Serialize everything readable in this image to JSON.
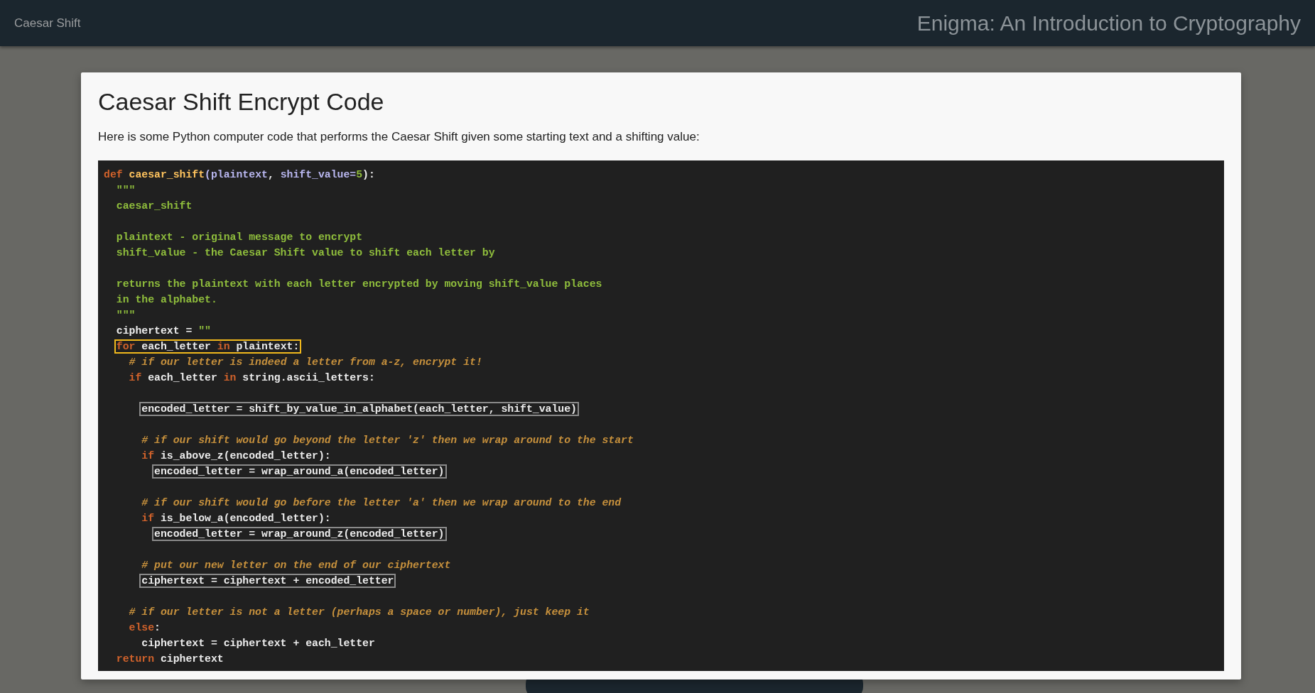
{
  "header": {
    "brand": "Caesar Shift",
    "title": "Enigma: An Introduction to Cryptography"
  },
  "modal": {
    "title": "Caesar Shift Encrypt Code",
    "intro": "Here is some Python computer code that performs the Caesar Shift given some starting text and a shifting value:",
    "lines": [
      {
        "kind": "code",
        "tokens": [
          {
            "kind": "kw",
            "text": "def "
          },
          {
            "kind": "fn",
            "text": "caesar_shift"
          },
          {
            "kind": "param",
            "text": "(plaintext"
          },
          {
            "kind": "plain",
            "text": ", "
          },
          {
            "kind": "param",
            "text": "shift_value="
          },
          {
            "kind": "num",
            "text": "5"
          },
          {
            "kind": "plain",
            "text": "):"
          }
        ],
        "children": [
          {
            "kind": "code",
            "tokens": [
              {
                "kind": "doc",
                "text": "\"\"\""
              }
            ]
          },
          {
            "kind": "code",
            "tokens": [
              {
                "kind": "doc",
                "text": "caesar_shift"
              }
            ]
          },
          {
            "kind": "blank"
          },
          {
            "kind": "code",
            "tokens": [
              {
                "kind": "doc",
                "text": "plaintext - original message to encrypt"
              }
            ]
          },
          {
            "kind": "code",
            "tokens": [
              {
                "kind": "doc",
                "text": "shift_value - the Caesar Shift value to shift each letter by"
              }
            ]
          },
          {
            "kind": "blank"
          },
          {
            "kind": "code",
            "tokens": [
              {
                "kind": "doc",
                "text": "returns the plaintext with each letter encrypted by moving shift_value places"
              }
            ]
          },
          {
            "kind": "code",
            "tokens": [
              {
                "kind": "doc",
                "text": "in the alphabet."
              }
            ]
          },
          {
            "kind": "code",
            "tokens": [
              {
                "kind": "doc",
                "text": "\"\"\""
              }
            ]
          },
          {
            "kind": "code",
            "tokens": [
              {
                "kind": "plain",
                "text": "ciphertext = "
              },
              {
                "kind": "doc",
                "text": "\"\""
              }
            ]
          },
          {
            "kind": "code",
            "boxed": true,
            "color": "#f0b81c",
            "tokens": [
              {
                "kind": "kw",
                "text": "for"
              },
              {
                "kind": "plain",
                "text": " each_letter "
              },
              {
                "kind": "kw",
                "text": "in"
              },
              {
                "kind": "plain",
                "text": " plaintext:"
              }
            ],
            "children": [
              {
                "kind": "code",
                "tokens": [
                  {
                    "kind": "comment",
                    "text": "# if our letter is indeed a letter from a-z, encrypt it!"
                  }
                ]
              },
              {
                "kind": "code",
                "tokens": [
                  {
                    "kind": "kw",
                    "text": "if"
                  },
                  {
                    "kind": "plain",
                    "text": " each_letter "
                  },
                  {
                    "kind": "kw",
                    "text": "in"
                  },
                  {
                    "kind": "plain",
                    "text": " string.ascii_letters:"
                  }
                ],
                "children": [
                  {
                    "kind": "blank"
                  },
                  {
                    "kind": "code",
                    "boxed": true,
                    "color": "#8a8a8a",
                    "tokens": [
                      {
                        "kind": "plain",
                        "text": "encoded_letter = shift_by_value_in_alphabet(each_letter, shift_value)"
                      }
                    ]
                  },
                  {
                    "kind": "blank"
                  },
                  {
                    "kind": "code",
                    "tokens": [
                      {
                        "kind": "comment",
                        "text": "# if our shift would go beyond the letter 'z' then we wrap around to the start"
                      }
                    ]
                  },
                  {
                    "kind": "code",
                    "tokens": [
                      {
                        "kind": "kw",
                        "text": "if"
                      },
                      {
                        "kind": "plain",
                        "text": " is_above_z(encoded_letter):"
                      }
                    ],
                    "children": [
                      {
                        "kind": "code",
                        "boxed": true,
                        "color": "#8a8a8a",
                        "tokens": [
                          {
                            "kind": "plain",
                            "text": "encoded_letter = wrap_around_a(encoded_letter)"
                          }
                        ]
                      }
                    ]
                  },
                  {
                    "kind": "blank"
                  },
                  {
                    "kind": "code",
                    "tokens": [
                      {
                        "kind": "comment",
                        "text": "# if our shift would go before the letter 'a' then we wrap around to the end"
                      }
                    ]
                  },
                  {
                    "kind": "code",
                    "tokens": [
                      {
                        "kind": "kw",
                        "text": "if"
                      },
                      {
                        "kind": "plain",
                        "text": " is_below_a(encoded_letter):"
                      }
                    ],
                    "children": [
                      {
                        "kind": "code",
                        "boxed": true,
                        "color": "#8a8a8a",
                        "tokens": [
                          {
                            "kind": "plain",
                            "text": "encoded_letter = wrap_around_z(encoded_letter)"
                          }
                        ]
                      }
                    ]
                  },
                  {
                    "kind": "blank"
                  },
                  {
                    "kind": "code",
                    "tokens": [
                      {
                        "kind": "comment",
                        "text": "# put our new letter on the end of our ciphertext"
                      }
                    ]
                  },
                  {
                    "kind": "code",
                    "boxed": true,
                    "color": "#8a8a8a",
                    "tokens": [
                      {
                        "kind": "plain",
                        "text": "ciphertext = ciphertext + encoded_letter"
                      }
                    ]
                  }
                ]
              },
              {
                "kind": "blank"
              },
              {
                "kind": "code",
                "tokens": [
                  {
                    "kind": "comment",
                    "text": "# if our letter is not a letter (perhaps a space or number), just keep it"
                  }
                ]
              },
              {
                "kind": "code",
                "tokens": [
                  {
                    "kind": "kw",
                    "text": "else"
                  },
                  {
                    "kind": "plain",
                    "text": ":"
                  }
                ],
                "children": [
                  {
                    "kind": "code",
                    "tokens": [
                      {
                        "kind": "plain",
                        "text": "ciphertext = ciphertext + each_letter"
                      }
                    ]
                  }
                ]
              }
            ]
          },
          {
            "kind": "code",
            "tokens": [
              {
                "kind": "kw",
                "text": "return"
              },
              {
                "kind": "plain",
                "text": " ciphertext"
              }
            ]
          }
        ]
      }
    ]
  }
}
